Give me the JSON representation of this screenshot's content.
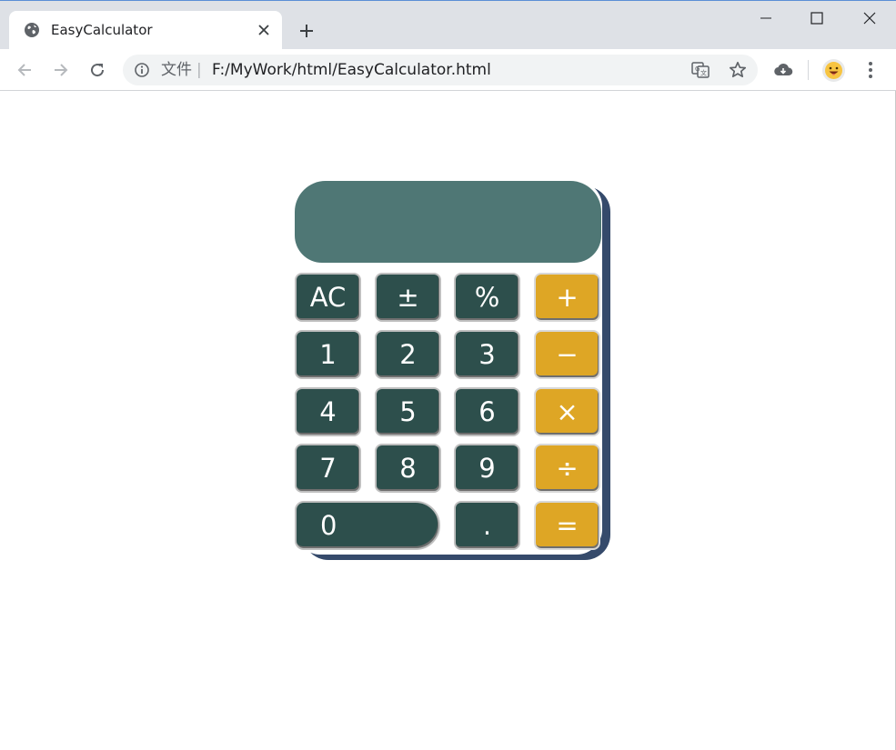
{
  "browser": {
    "tab_title": "EasyCalculator",
    "omnibox_label": "文件",
    "omnibox_separator": "|",
    "url": "F:/MyWork/html/EasyCalculator.html"
  },
  "calculator": {
    "display_value": "",
    "colors": {
      "display": "#4f7775",
      "key": "#2d4f4c",
      "operator_key": "#dea625",
      "shadow": "#354a6b"
    },
    "keys": {
      "ac": "AC",
      "plus_minus": "±",
      "percent": "%",
      "add": "+",
      "one": "1",
      "two": "2",
      "three": "3",
      "subtract": "−",
      "four": "4",
      "five": "5",
      "six": "6",
      "multiply": "×",
      "seven": "7",
      "eight": "8",
      "nine": "9",
      "divide": "÷",
      "zero": "0",
      "decimal": ".",
      "equals": "="
    }
  }
}
